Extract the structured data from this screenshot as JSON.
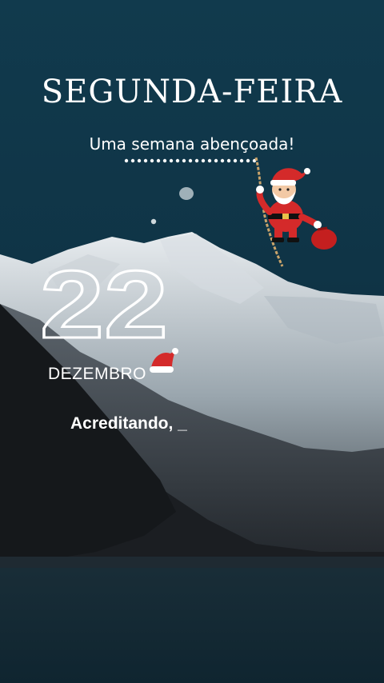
{
  "header": {
    "title": "SEGUNDA-FEIRA",
    "subtitle": "Uma semana abençoada!"
  },
  "date": {
    "day": "22",
    "month": "DEZEMBRO"
  },
  "message": {
    "text": "Acreditando, _"
  },
  "decorations": {
    "santa": "santa-claus-climbing-rope-icon",
    "hat": "santa-hat-icon"
  },
  "colors": {
    "sky": "#113a4d",
    "text": "#ffffff",
    "santa_red": "#d42a2a"
  }
}
